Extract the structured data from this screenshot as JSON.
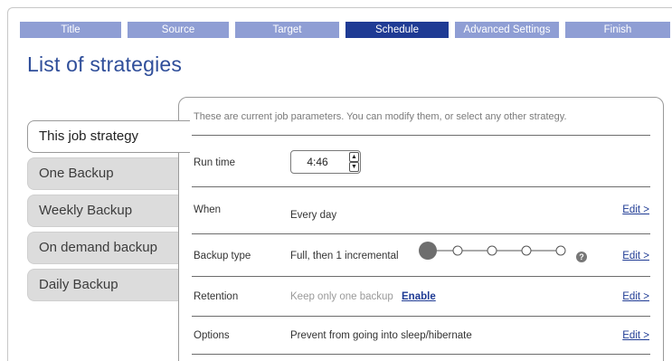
{
  "wizard_steps": [
    {
      "label": "Title",
      "active": false
    },
    {
      "label": "Source",
      "active": false
    },
    {
      "label": "Target",
      "active": false
    },
    {
      "label": "Schedule",
      "active": true
    },
    {
      "label": "Advanced Settings",
      "active": false
    },
    {
      "label": "Finish",
      "active": false
    }
  ],
  "page_title": "List of strategies",
  "strategies": [
    {
      "label": "This job strategy",
      "selected": true
    },
    {
      "label": "One Backup",
      "selected": false
    },
    {
      "label": "Weekly Backup",
      "selected": false
    },
    {
      "label": "On demand backup",
      "selected": false
    },
    {
      "label": "Daily Backup",
      "selected": false
    }
  ],
  "panel": {
    "intro": "These are current job parameters. You can modify them, or select any other strategy.",
    "run_time": {
      "label": "Run time",
      "value": "4:46"
    },
    "when": {
      "label": "When",
      "value": "Every day",
      "edit": "Edit >"
    },
    "backup_type": {
      "label": "Backup type",
      "value": "Full, then 1 incremental",
      "edit": "Edit >",
      "help": "?"
    },
    "retention": {
      "label": "Retention",
      "value": "Keep only one backup",
      "action": "Enable",
      "edit": "Edit >"
    },
    "options": {
      "label": "Options",
      "value": "Prevent from going into sleep/hibernate",
      "edit": "Edit >"
    }
  },
  "colors": {
    "step_inactive": "#8f9ed4",
    "step_active": "#1f3b94",
    "title": "#2f4e9a",
    "link": "#1f3b94"
  }
}
